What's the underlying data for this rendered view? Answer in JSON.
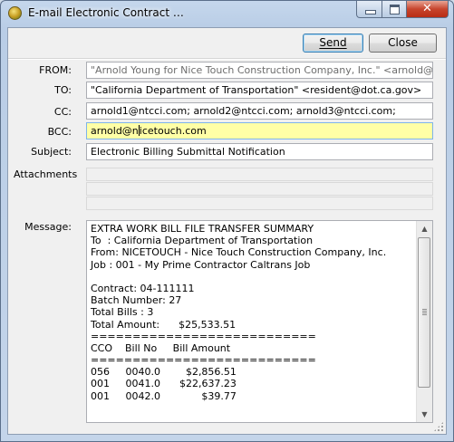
{
  "window": {
    "title": "E-mail Electronic Contract Data...",
    "close_glyph": "✕"
  },
  "toolbar": {
    "send_label": "Send",
    "close_label": "Close"
  },
  "form": {
    "from_label": "FROM:",
    "from_value": "\"Arnold Young for Nice Touch Construction Company, Inc.\" <arnold@nicetouch.com>",
    "to_label": "TO:",
    "to_value": "\"California Department of Transportation\" <resident@dot.ca.gov>",
    "cc_label": "CC:",
    "cc_value": "arnold1@ntcci.com; arnold2@ntcci.com; arnold3@ntcci.com;",
    "bcc_label": "BCC:",
    "bcc_value_before_caret": "arnold@n",
    "bcc_value_after_caret": "icetouch.com",
    "subject_label": "Subject:",
    "subject_value": "Electronic Billing Submittal Notification",
    "attachments_label": "Attachments",
    "message_label": "Message:"
  },
  "message": {
    "lines": [
      "EXTRA WORK BILL FILE TRANSFER SUMMARY",
      "To  : California Department of Transportation",
      "From: NICETOUCH - Nice Touch Construction Company, Inc.",
      "Job : 001 - My Prime Contractor Caltrans Job",
      "",
      "Contract: 04-111111",
      "Batch Number: 27",
      "Total Bills : 3",
      "Total Amount:      $25,533.51",
      "===========================",
      "CCO    Bill No     Bill Amount",
      "===========================",
      "056     0040.0        $2,856.51",
      "001     0041.0      $22,637.23",
      "001     0042.0             $39.77"
    ]
  },
  "icons": {
    "app": "app-icon",
    "minimize": "minimize-icon",
    "maximize": "maximize-icon",
    "close": "close-icon",
    "scroll_up": "scroll-up-arrow-icon",
    "scroll_down": "scroll-down-arrow-icon"
  }
}
